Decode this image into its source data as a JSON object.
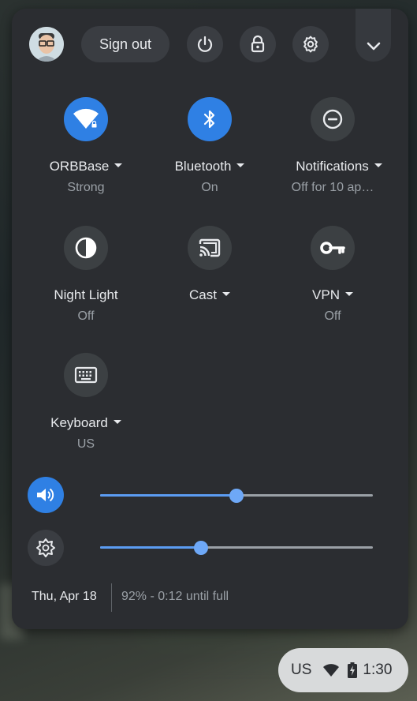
{
  "header": {
    "signout_label": "Sign out",
    "icons": [
      "power-icon",
      "lock-icon",
      "gear-icon",
      "chevron-down-icon"
    ]
  },
  "tiles": [
    {
      "label": "ORBBase",
      "sub": "Strong",
      "icon": "wifi-icon",
      "on": true,
      "has_menu": true
    },
    {
      "label": "Bluetooth",
      "sub": "On",
      "icon": "bluetooth-icon",
      "on": true,
      "has_menu": true
    },
    {
      "label": "Notifications",
      "sub": "Off for 10 ap…",
      "icon": "do-not-disturb-icon",
      "on": false,
      "has_menu": true
    },
    {
      "label": "Night Light",
      "sub": "Off",
      "icon": "night-light-icon",
      "on": false,
      "has_menu": false
    },
    {
      "label": "Cast",
      "sub": "",
      "icon": "cast-icon",
      "on": false,
      "has_menu": true
    },
    {
      "label": "VPN",
      "sub": "Off",
      "icon": "vpn-key-icon",
      "on": false,
      "has_menu": true
    },
    {
      "label": "Keyboard",
      "sub": "US",
      "icon": "keyboard-icon",
      "on": false,
      "has_menu": true
    }
  ],
  "sliders": {
    "volume": {
      "level": 0.5,
      "icon": "volume-icon"
    },
    "brightness": {
      "level": 0.37,
      "icon": "brightness-icon"
    }
  },
  "footer": {
    "date": "Thu, Apr 18",
    "battery": "92% - 0:12 until full"
  },
  "shelf": {
    "ime": "US",
    "time": "1:30"
  },
  "colors": {
    "panel": "#2b2d31",
    "accent": "#2f80e4",
    "text": "#e8eaed",
    "subtext": "#9aa0a6"
  }
}
